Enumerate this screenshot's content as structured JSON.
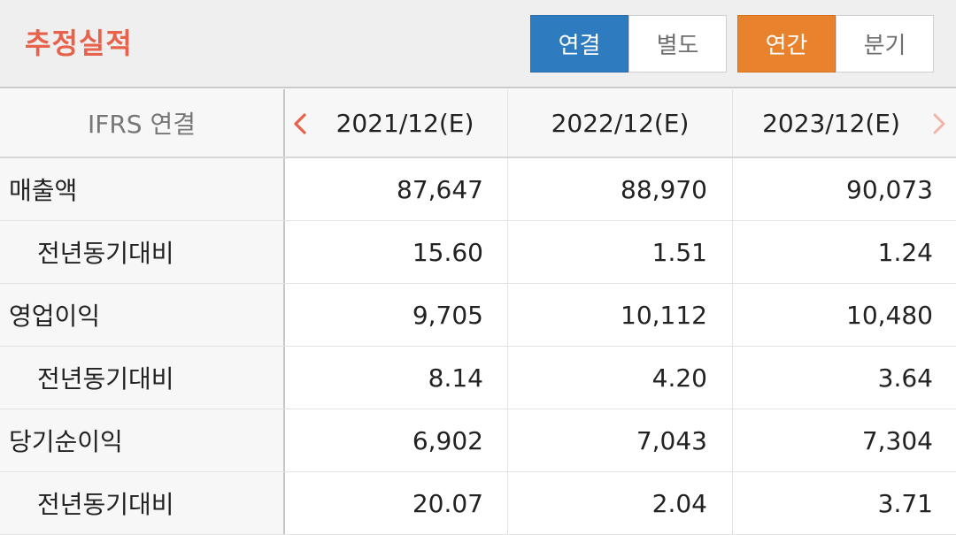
{
  "header": {
    "title": "추정실적",
    "scope_toggle": {
      "consolidated": "연결",
      "separate": "별도",
      "selected": "연결"
    },
    "period_toggle": {
      "annual": "연간",
      "quarter": "분기",
      "selected": "연간"
    }
  },
  "colors": {
    "title": "#e8614a",
    "active_blue": "#2f7bbf",
    "active_orange": "#e9822c",
    "prev_arrow": "#e8614a",
    "next_arrow": "#f2b4a8"
  },
  "table": {
    "corner_label": "IFRS 연결",
    "nav_icons": [
      "chevron-left-icon",
      "chevron-right-icon"
    ],
    "columns": [
      "2021/12(E)",
      "2022/12(E)",
      "2023/12(E)"
    ],
    "rows": [
      {
        "label": "매출액",
        "sub": false,
        "values": [
          "87,647",
          "88,970",
          "90,073"
        ]
      },
      {
        "label": "전년동기대비",
        "sub": true,
        "values": [
          "15.60",
          "1.51",
          "1.24"
        ]
      },
      {
        "label": "영업이익",
        "sub": false,
        "values": [
          "9,705",
          "10,112",
          "10,480"
        ]
      },
      {
        "label": "전년동기대비",
        "sub": true,
        "values": [
          "8.14",
          "4.20",
          "3.64"
        ]
      },
      {
        "label": "당기순이익",
        "sub": false,
        "values": [
          "6,902",
          "7,043",
          "7,304"
        ]
      },
      {
        "label": "전년동기대비",
        "sub": true,
        "values": [
          "20.07",
          "2.04",
          "3.71"
        ]
      }
    ]
  }
}
